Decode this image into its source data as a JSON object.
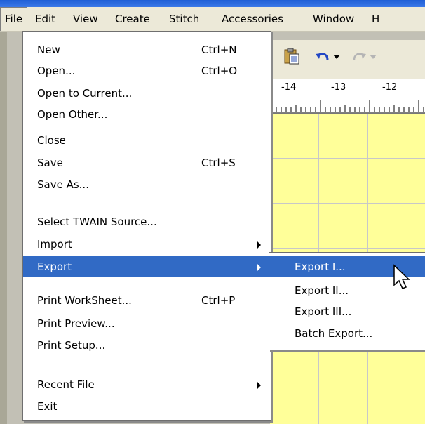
{
  "menubar": {
    "items": [
      {
        "label": "File"
      },
      {
        "label": "Edit"
      },
      {
        "label": "View"
      },
      {
        "label": "Create"
      },
      {
        "label": "Stitch"
      },
      {
        "label": "Accessories"
      },
      {
        "label": "Window"
      },
      {
        "label": "H"
      }
    ]
  },
  "file_menu": {
    "items": [
      {
        "label": "New",
        "shortcut": "Ctrl+N"
      },
      {
        "label": "Open...",
        "shortcut": "Ctrl+O"
      },
      {
        "label": "Open to Current..."
      },
      {
        "label": "Open Other..."
      },
      {
        "label": "Close"
      },
      {
        "label": "Save",
        "shortcut": "Ctrl+S"
      },
      {
        "label": "Save As..."
      },
      {
        "label": "Select TWAIN Source..."
      },
      {
        "label": "Import",
        "has_submenu": true
      },
      {
        "label": "Export",
        "has_submenu": true,
        "highlighted": true
      },
      {
        "label": "Print WorkSheet...",
        "shortcut": "Ctrl+P"
      },
      {
        "label": "Print Preview..."
      },
      {
        "label": "Print Setup..."
      },
      {
        "label": "Recent File",
        "has_submenu": true
      },
      {
        "label": "Exit"
      }
    ]
  },
  "export_submenu": {
    "items": [
      {
        "label": "Export I...",
        "highlighted": true
      },
      {
        "label": "Export II..."
      },
      {
        "label": "Export III..."
      },
      {
        "label": "Batch Export..."
      }
    ]
  },
  "toolbar": {
    "icons": [
      "paste-icon",
      "undo-icon",
      "undo-dropdown-icon",
      "redo-icon",
      "redo-dropdown-icon"
    ]
  },
  "ruler": {
    "labels": [
      "-14",
      "-13",
      "-12"
    ]
  },
  "colors": {
    "highlight": "#316ac5",
    "menu_bg": "#ffffff",
    "menubar_bg": "#ece9d8",
    "canvas": "#ffff99",
    "grid_line": "#c8c8c8"
  }
}
